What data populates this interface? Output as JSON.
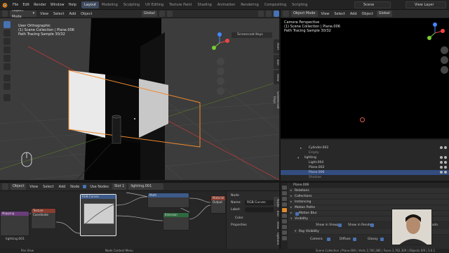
{
  "topbar": {
    "menus": [
      "File",
      "Edit",
      "Render",
      "Window",
      "Help"
    ],
    "workspaces": [
      "Layout",
      "Modeling",
      "Sculpting",
      "UV Editing",
      "Texture Paint",
      "Shading",
      "Animation",
      "Rendering",
      "Compositing",
      "Scripting"
    ],
    "active_workspace": "Layout",
    "scene": "Scene",
    "view_layer": "View Layer"
  },
  "viewport": {
    "mode": "Object Mode",
    "menus": [
      "View",
      "Select",
      "Add",
      "Object"
    ],
    "transform": "Global",
    "overlay_lines": [
      "User Orthographic",
      "(1) Scene Collection | Plane.006",
      "Path Tracing Sample 30/32"
    ],
    "screencast_label": "Screencast Keys",
    "side_tabs": [
      "Item",
      "Tool",
      "View",
      "Screencast Keys"
    ]
  },
  "camera_view": {
    "mode": "Object Mode",
    "menus": [
      "View",
      "Select",
      "Add",
      "Object"
    ],
    "transform": "Global",
    "overlay_lines": [
      "Camera Perspective",
      "(1) Scene Collection | Plane.006",
      "Path Tracing Sample 30/32"
    ]
  },
  "outliner": {
    "rows": [
      {
        "name": "Cylinder.002",
        "selected": false
      },
      {
        "name": "Empty",
        "selected": false
      },
      {
        "name": "lighting",
        "selected": false
      },
      {
        "name": "Light.004",
        "selected": false
      },
      {
        "name": "Plane.002",
        "selected": false
      },
      {
        "name": "Plane.006",
        "selected": true
      },
      {
        "name": "Shadow",
        "selected": false
      }
    ]
  },
  "node_editor": {
    "editor": "Object",
    "menus": [
      "View",
      "Select",
      "Add",
      "Node"
    ],
    "use_nodes_label": "Use Nodes",
    "slot": "Slot 1",
    "material": "lighting.001",
    "nodes": [
      {
        "title": "Mapping",
        "color": "#6a3d7a"
      },
      {
        "title": "Texture Coordinate",
        "color": "#8a3d2f"
      },
      {
        "title": "RGB Curves",
        "color": "#3d5a8a"
      },
      {
        "title": "Math",
        "color": "#3d5a8a"
      },
      {
        "title": "Emission",
        "color": "#2d6a3d"
      },
      {
        "title": "Material Output",
        "color": "#8a3d2f"
      }
    ],
    "bottom_label": "lighting.001",
    "panel": {
      "section": "Node",
      "name_label": "Name:",
      "name_value": "RGB Curves",
      "label_label": "Label:",
      "color_section": "Color",
      "properties_section": "Properties",
      "tabs": [
        "Node",
        "Tool",
        "View",
        "Options"
      ]
    }
  },
  "properties": {
    "object_name": "Plane.006",
    "sections": [
      "Relations",
      "Collections",
      "Instancing",
      "Motion Paths",
      "Motion Blur",
      "Visibility"
    ],
    "visibility": {
      "show_in_viewports": "Show in Viewp.",
      "show_in_renders": "Show in Rende.",
      "selectable": "Selectable",
      "ray_visibility": "Ray Visibility",
      "rays": [
        "Camera",
        "Diffuse",
        "Glossy",
        "Transmission"
      ],
      "shadow": "Shado"
    }
  },
  "status": {
    "left": "Pan View",
    "middle": "Node Context Menu",
    "right": "Scene Collection | Plane.006 | Verts 2,760,386 | Faces 2,762,309 | Objects 0/9 | 3.0.1"
  },
  "colors": {
    "accent": "#4772b3",
    "selection_orange": "#f08a2d",
    "active_workspace": "#3e4a5e"
  }
}
